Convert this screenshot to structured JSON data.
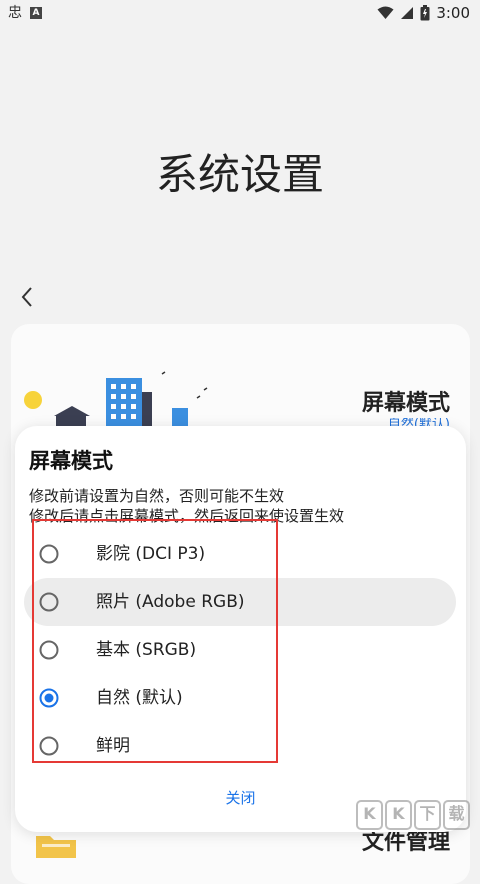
{
  "status_bar": {
    "app_icon": "忠",
    "a_icon": "A",
    "time": "3:00",
    "icons": [
      "wifi-icon",
      "signal-icon",
      "battery-icon"
    ]
  },
  "page": {
    "title": "系统设置"
  },
  "background_card": {
    "mode_title": "屏幕模式",
    "mode_current": "自然(默认)",
    "file_title": "文件管理"
  },
  "dialog": {
    "title": "屏幕模式",
    "hint_line1": "修改前请设置为自然，否则可能不生效",
    "hint_line2": "修改后请点击屏幕模式，然后返回来使设置生效",
    "options": [
      {
        "label": "影院 (DCI P3)",
        "selected": false
      },
      {
        "label": "照片 (Adobe RGB)",
        "selected": false
      },
      {
        "label": "基本 (SRGB)",
        "selected": false
      },
      {
        "label": "自然 (默认)",
        "selected": true
      },
      {
        "label": "鲜明",
        "selected": false
      }
    ],
    "close_label": "关闭"
  },
  "watermark": {
    "chars": [
      "K",
      "K",
      "下",
      "载"
    ]
  },
  "colors": {
    "accent": "#1a73e8",
    "highlight_border": "#e53935",
    "building": "#3b8fe0"
  }
}
